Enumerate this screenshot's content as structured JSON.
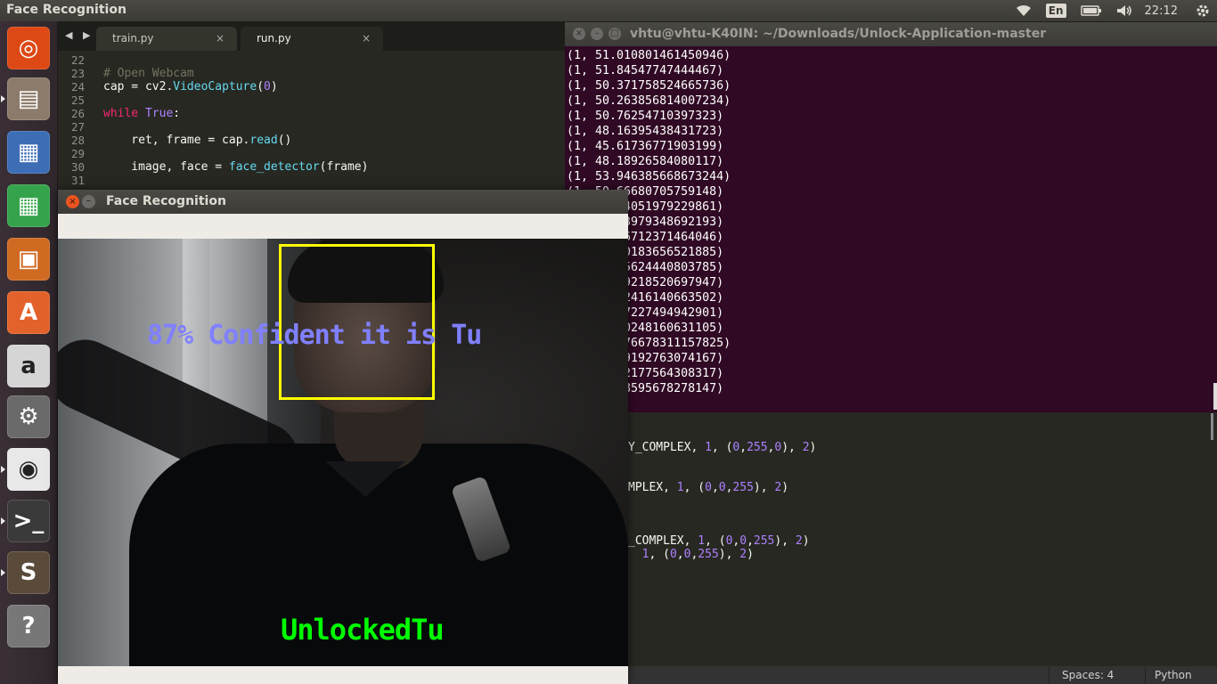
{
  "top_panel": {
    "app_title": "Face Recognition",
    "keyboard_layout": "En",
    "clock": "22:12",
    "icons": [
      "wifi-icon",
      "keyboard-icon",
      "battery-icon",
      "volume-icon",
      "gear-icon"
    ]
  },
  "launcher": {
    "items": [
      {
        "name": "ubuntu-dash",
        "color": "#dd4814",
        "glyph": "◎"
      },
      {
        "name": "files",
        "color": "#8c7b6a",
        "glyph": "▤"
      },
      {
        "name": "libreoffice-writer",
        "color": "#3d6db5",
        "glyph": "▦"
      },
      {
        "name": "libreoffice-calc",
        "color": "#35a34b",
        "glyph": "▦"
      },
      {
        "name": "libreoffice-impress",
        "color": "#d06a23",
        "glyph": "▣"
      },
      {
        "name": "ubuntu-software",
        "color": "#e3622b",
        "glyph": "A"
      },
      {
        "name": "amazon",
        "color": "#d5d5d5",
        "glyph": "a"
      },
      {
        "name": "system-settings",
        "color": "#6a6a6a",
        "glyph": "⚙"
      },
      {
        "name": "chrome",
        "color": "#e8e8e8",
        "glyph": "◉"
      },
      {
        "name": "terminal",
        "color": "#3a3a3a",
        "glyph": ">_"
      },
      {
        "name": "sublime-text",
        "color": "#5a4a3a",
        "glyph": "S"
      },
      {
        "name": "help",
        "color": "#777777",
        "glyph": "?"
      }
    ]
  },
  "editor": {
    "tabs": [
      {
        "label": "train.py",
        "close": "×"
      },
      {
        "label": "run.py",
        "close": "×"
      }
    ],
    "nav_arrows": "◀ ▶",
    "lines": [
      {
        "n": "22",
        "text": ""
      },
      {
        "n": "23",
        "text": "# Open Webcam"
      },
      {
        "n": "24",
        "text_a": "cap = cv2.",
        "text_b": "VideoCapture",
        "text_c": "(",
        "text_d": "0",
        "text_e": ")"
      },
      {
        "n": "25",
        "text": ""
      },
      {
        "n": "26",
        "text_a": "while",
        "text_b": " ",
        "text_c": "True",
        "text_d": ":"
      },
      {
        "n": "27",
        "text": ""
      },
      {
        "n": "28",
        "text_a": "    ret, frame = cap.",
        "text_b": "read",
        "text_c": "()"
      },
      {
        "n": "29",
        "text": ""
      },
      {
        "n": "30",
        "text_a": "    image, face = ",
        "text_b": "face_detector",
        "text_c": "(frame)"
      },
      {
        "n": "31",
        "text": ""
      }
    ],
    "lower_lines": [
      {
        "a": "Y_COMPLEX, ",
        "b": "1",
        "c": ", (",
        "d": "0",
        "e": ",",
        "f": "255",
        "g": ",",
        "h": "0",
        "i": "), ",
        "j": "2",
        "k": ")"
      },
      {
        "a": "MPLEX, ",
        "b": "1",
        "c": ", (",
        "d": "0",
        "e": ",",
        "f": "0",
        "g": ",",
        "h": "255",
        "i": "), ",
        "j": "2",
        "k": ")"
      },
      {
        "a": "_COMPLEX, ",
        "b": "1",
        "c": ", (",
        "d": "0",
        "e": ",",
        "f": "0",
        "g": ",",
        "h": "255",
        "i": "), ",
        "j": "2",
        "k": ")"
      },
      {
        "a": "  ",
        "b": "1",
        "c": ", (",
        "d": "0",
        "e": ",",
        "f": "0",
        "g": ",",
        "h": "255",
        "i": "), ",
        "j": "2",
        "k": ")"
      }
    ],
    "status": {
      "spaces": "Spaces: 4",
      "syntax": "Python"
    }
  },
  "terminal": {
    "title": "vhtu@vhtu-K40IN: ~/Downloads/Unlock-Application-master",
    "lines": [
      "(1, 51.010801461450946)",
      "(1, 51.84547747444467)",
      "(1, 50.371758524665736)",
      "(1, 50.263856814007234)",
      "(1, 50.76254710397323)",
      "(1, 48.16395438431723)",
      "(1, 45.61736771903199)",
      "(1, 48.18926584080117)",
      "(1, 53.946385668673244)",
      "(1, 50.66680705759148)",
      "(1, 51.84051979229861)",
      "(1, 51.43979348692193)",
      "(1, 50.46712371464046)",
      "(1, 49.70183656521885)",
      "(1, 50.95624440803785)",
      "(1, 52.09218520697947)",
      "(1, 50.02416140663502)",
      "(1, 49.57227494942901)",
      "(1, 50.80248160631105)",
      "(1, 51.176678311157825)",
      "(1, 49.09192763074167)",
      "(1, 50.02177564308317)",
      "(1, 51.18595678278147)"
    ]
  },
  "face_window": {
    "title": "Face Recognition",
    "close_glyph": "×",
    "minimize_glyph": "–",
    "overlay": {
      "confidence": "87% Confident it is Tu",
      "status": "UnlockedTu",
      "box_color": "#ffff00",
      "confidence_color": "#8080ff",
      "status_color": "#00ff00"
    }
  }
}
